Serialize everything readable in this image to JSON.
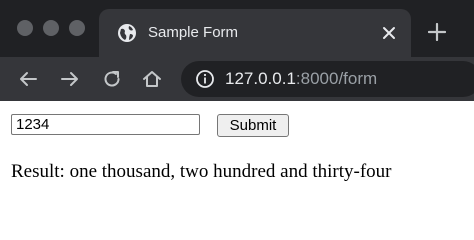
{
  "tab": {
    "title": "Sample Form"
  },
  "address_bar": {
    "host": "127.0.0.1",
    "rest": ":8000/form"
  },
  "form": {
    "input_value": "1234",
    "submit_label": "Submit"
  },
  "result": {
    "label": "Result:",
    "text": "one thousand, two hundred and thirty-four"
  },
  "colors": {
    "tab_strip": "#202124",
    "toolbar": "#35363a",
    "icon": "#c4c7c9"
  }
}
